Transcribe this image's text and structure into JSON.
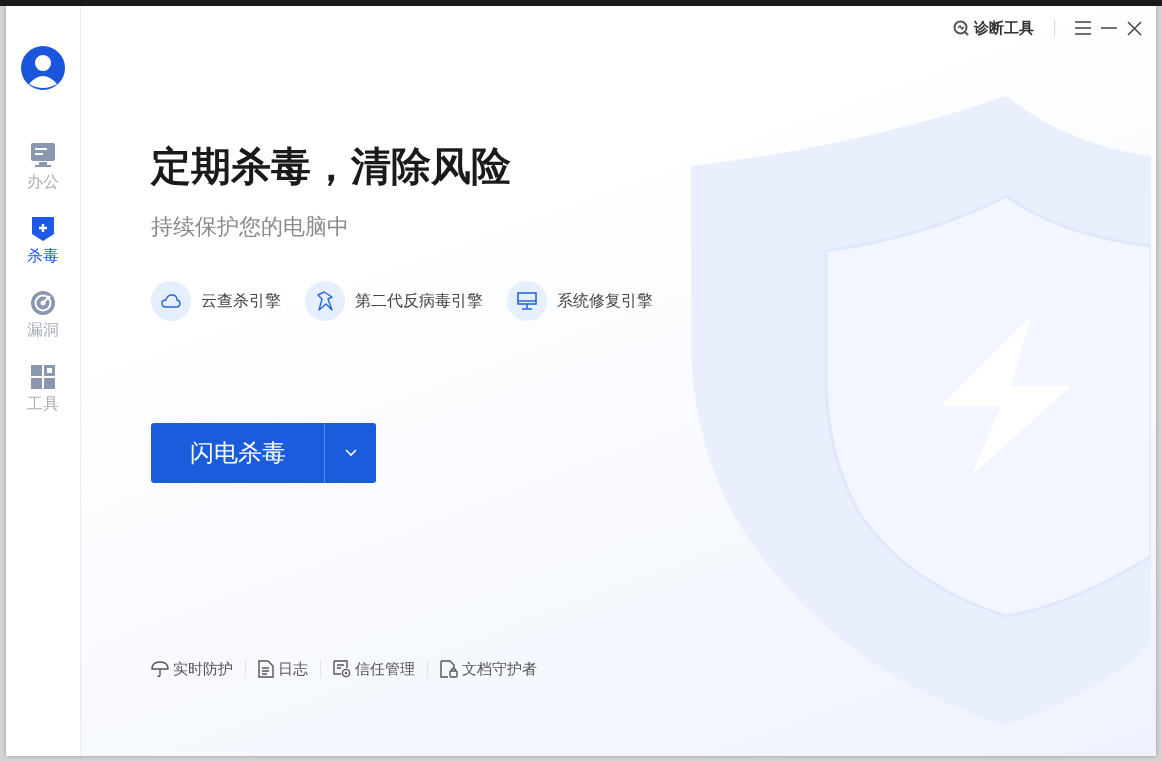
{
  "sidebar": {
    "items": [
      {
        "kind": "office",
        "label": "办公",
        "selected": false
      },
      {
        "kind": "antivirus",
        "label": "杀毒",
        "selected": true
      },
      {
        "kind": "vulnerability",
        "label": "漏洞",
        "selected": false
      },
      {
        "kind": "tools",
        "label": "工具",
        "selected": false
      }
    ]
  },
  "top_bar": {
    "diagnose": "诊断工具"
  },
  "headline": "定期杀毒，清除风险",
  "subtitle": "持续保护您的电脑中",
  "engines": [
    {
      "kind": "cloud",
      "label": "云查杀引擎"
    },
    {
      "kind": "bird",
      "label": "第二代反病毒引擎"
    },
    {
      "kind": "monitor",
      "label": "系统修复引擎"
    }
  ],
  "scan_button": {
    "label": "闪电杀毒"
  },
  "footer_links": [
    {
      "kind": "umbrella",
      "label": "实时防护"
    },
    {
      "kind": "document",
      "label": "日志"
    },
    {
      "kind": "trust",
      "label": "信任管理"
    },
    {
      "kind": "docguard",
      "label": "文档守护者"
    }
  ]
}
